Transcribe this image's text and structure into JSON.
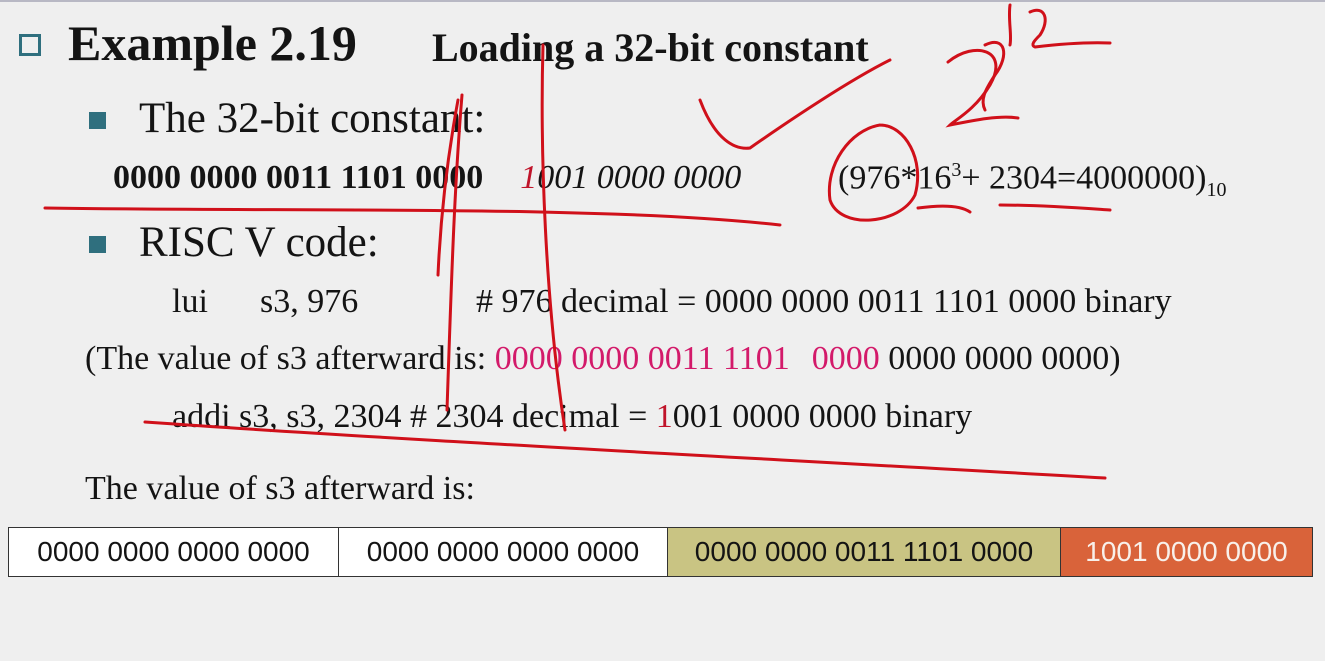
{
  "slide": {
    "title": "Example 2.19",
    "subtitle": "Loading a 32-bit constant",
    "bullet1": "The 32-bit constant:",
    "constant_upper_bold": "0000 0000 0011 1101 0000",
    "constant_red_digit": "1",
    "constant_lower_italic": "001 0000 0000",
    "formula": {
      "prefix": "(976*16",
      "exp": "3",
      "mid": "+ 2304=4000000)",
      "base": "10"
    },
    "bullet2": "RISC V code:",
    "code1": {
      "instr": "lui",
      "args": "s3, 976",
      "comment": "# 976 decimal = 0000 0000 0011 1101 0000 binary"
    },
    "value1": {
      "prefix": "(The value of s3 afterward is: ",
      "highlight1": "0000 0000 0011 1101",
      "highlight2": "0000",
      "rest": " 0000 0000 0000)"
    },
    "code2": {
      "text": "addi s3, s3, 2304 # 2304 decimal = ",
      "red_digit": "1",
      "tail": "001 0000 0000 binary"
    },
    "value2_label": "The value of s3 afterward is:",
    "register": [
      "0000 0000 0000 0000",
      "0000 0000 0000 0000",
      "0000 0000 0011 1101 0000",
      "1001 0000 0000"
    ]
  },
  "colors": {
    "accent": "#2f6f7e",
    "red": "#c0142a",
    "magenta": "#d31a6a",
    "yellow_cell": "#c9c483",
    "orange_cell": "#d9633a",
    "ink": "#d0101a"
  }
}
